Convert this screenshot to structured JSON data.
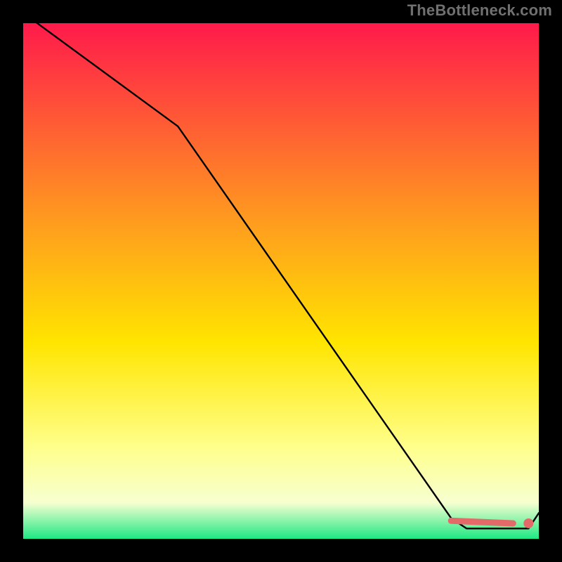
{
  "watermark": "TheBottleneck.com",
  "colors": {
    "bg": "#000000",
    "grad_top": "#ff1a4b",
    "grad_mid1": "#ff9a1f",
    "grad_mid2": "#ffe500",
    "grad_mid3": "#ffff8a",
    "grad_mid4": "#f7ffd0",
    "grad_bottom": "#1ee884",
    "line": "#000000",
    "marker": "#e46a6a"
  },
  "chart_data": {
    "type": "line",
    "title": "",
    "xlabel": "",
    "ylabel": "",
    "xlim": [
      0,
      100
    ],
    "ylim": [
      0,
      100
    ],
    "series": [
      {
        "name": "bottleneck-curve",
        "x": [
          0,
          30,
          83,
          86,
          92,
          98,
          100
        ],
        "y": [
          102,
          80,
          4,
          2,
          2,
          2,
          5
        ]
      }
    ],
    "markers": [
      {
        "name": "flat-segment",
        "type": "thick-line",
        "x": [
          83,
          95
        ],
        "y": [
          3.5,
          3
        ]
      },
      {
        "name": "dot",
        "type": "point",
        "x": 98,
        "y": 3
      }
    ]
  }
}
